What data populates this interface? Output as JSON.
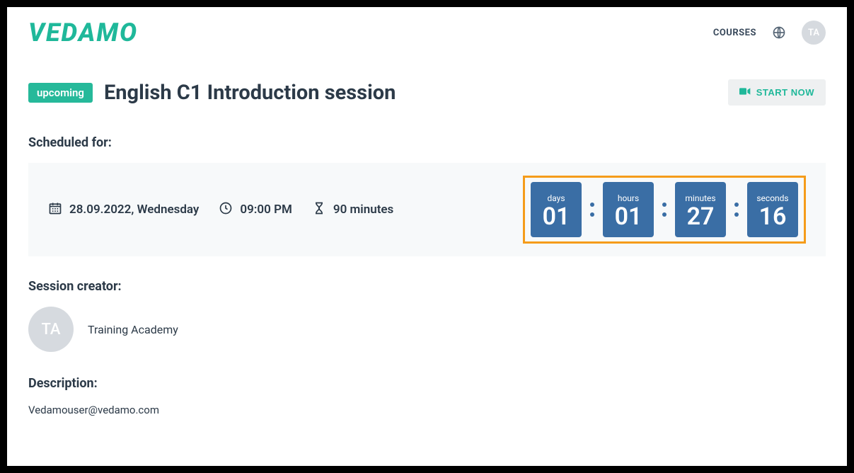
{
  "header": {
    "logo": "VEDAMO",
    "courses_link": "COURSES",
    "avatar_initials": "TA"
  },
  "session": {
    "status_badge": "upcoming",
    "title": "English C1 Introduction session",
    "start_button": "START NOW"
  },
  "scheduled": {
    "label": "Scheduled for:",
    "date": "28.09.2022, Wednesday",
    "time": "09:00 PM",
    "duration": "90 minutes"
  },
  "countdown": {
    "days_label": "days",
    "days": "01",
    "hours_label": "hours",
    "hours": "01",
    "minutes_label": "minutes",
    "minutes": "27",
    "seconds_label": "seconds",
    "seconds": "16"
  },
  "creator": {
    "label": "Session creator:",
    "initials": "TA",
    "name": "Training Academy"
  },
  "description": {
    "label": "Description:",
    "text": "Vedamouser@vedamo.com"
  }
}
